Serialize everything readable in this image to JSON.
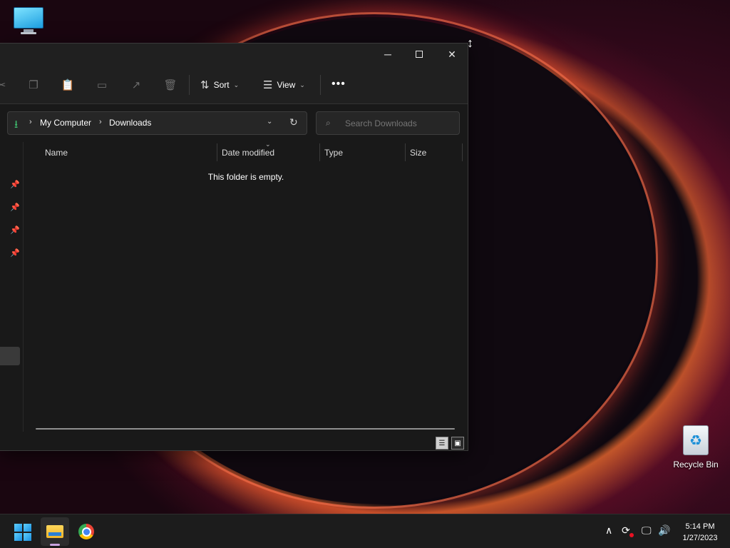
{
  "desktop": {
    "recycle_bin_label": "Recycle Bin"
  },
  "window": {
    "controls": {
      "minimize": "─",
      "close": "✕"
    },
    "toolbar": {
      "sort_label": "Sort",
      "view_label": "View",
      "more_label": "•••",
      "icons": [
        "cut-icon",
        "copy-icon",
        "paste-icon",
        "rename-icon",
        "share-icon",
        "delete-icon"
      ]
    },
    "address": {
      "items": [
        "My Computer",
        "Downloads"
      ]
    },
    "search": {
      "placeholder": "Search Downloads"
    },
    "columns": [
      "Name",
      "Date modified",
      "Type",
      "Size"
    ],
    "empty_message": "This folder is empty."
  },
  "taskbar": {
    "apps": [
      "File Explorer",
      "Google Chrome"
    ],
    "clock": {
      "time": "5:14 PM",
      "date": "1/27/2023"
    }
  },
  "colors": {
    "accent": "#3fbf6f",
    "window_bg": "#191919",
    "taskbar_bg": "#1c1c1c"
  }
}
